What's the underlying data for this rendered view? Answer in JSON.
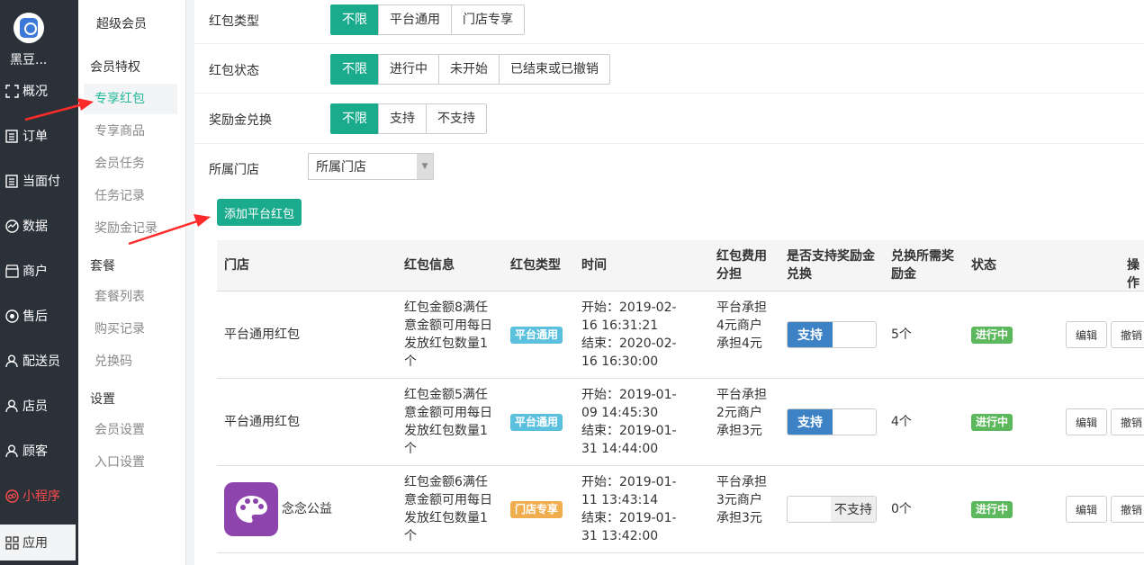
{
  "nav": {
    "brand": "黑豆...",
    "items": [
      {
        "label": "概况",
        "icon": "overview-icon"
      },
      {
        "label": "订单",
        "icon": "order-icon"
      },
      {
        "label": "当面付",
        "icon": "face-pay-icon"
      },
      {
        "label": "数据",
        "icon": "data-icon"
      },
      {
        "label": "商户",
        "icon": "merchant-icon"
      },
      {
        "label": "售后",
        "icon": "after-sale-icon"
      },
      {
        "label": "配送员",
        "icon": "courier-icon"
      },
      {
        "label": "店员",
        "icon": "clerk-icon"
      },
      {
        "label": "顾客",
        "icon": "customer-icon"
      },
      {
        "label": "小程序",
        "icon": "mini-program-icon"
      },
      {
        "label": "应用",
        "icon": "apps-icon"
      }
    ],
    "accent_red": "#ff4a4a"
  },
  "submenu": {
    "title": "超级会员",
    "group1": "会员特权",
    "links1": [
      "专享红包",
      "专享商品",
      "会员任务",
      "任务记录",
      "奖励金记录"
    ],
    "group2": "套餐",
    "links2": [
      "套餐列表",
      "购买记录",
      "兑换码"
    ],
    "group3": "设置",
    "links3": [
      "会员设置",
      "入口设置"
    ]
  },
  "filters": {
    "type": {
      "label": "红包类型",
      "options": [
        "不限",
        "平台通用",
        "门店专享"
      ]
    },
    "status": {
      "label": "红包状态",
      "options": [
        "不限",
        "进行中",
        "未开始",
        "已结束或已撤销"
      ]
    },
    "reward": {
      "label": "奖励金兑换",
      "options": [
        "不限",
        "支持",
        "不支持"
      ]
    },
    "store": {
      "label": "所属门店",
      "value": "所属门店"
    }
  },
  "add_button": "添加平台红包",
  "accent_color": "#1aaa8c",
  "table": {
    "headers": {
      "store": "门店",
      "info": "红包信息",
      "type": "红包类型",
      "time": "时间",
      "cost": "红包费用分担",
      "reward": "是否支持奖励金兑换",
      "needed": "兑换所需奖励金",
      "status": "状态",
      "ops": "操作"
    },
    "rows": [
      {
        "store": "平台通用红包",
        "info": "红包金额8满任意金额可用每日发放红包数量1个",
        "type": "平台通用",
        "start": "开始：2019-02-16 16:31:21",
        "end": "结束：2020-02-16 16:30:00",
        "cost": "平台承担4元商户承担4元",
        "reward": "支持",
        "needed": "5个",
        "status": "进行中",
        "edit": "编辑",
        "revoke": "撤销"
      },
      {
        "store": "平台通用红包",
        "info": "红包金额5满任意金额可用每日发放红包数量1个",
        "type": "平台通用",
        "start": "开始：2019-01-09 14:45:30",
        "end": "结束：2019-01-31 14:44:00",
        "cost": "平台承担2元商户承担3元",
        "reward": "支持",
        "needed": "4个",
        "status": "进行中",
        "edit": "编辑",
        "revoke": "撤销"
      },
      {
        "store": "念念公益",
        "info": "红包金额6满任意金额可用每日发放红包数量1个",
        "type": "门店专享",
        "start": "开始：2019-01-11 13:43:14",
        "end": "结束：2019-01-31 13:42:00",
        "cost": "平台承担3元商户承担3元",
        "reward": "不支持",
        "needed": "0个",
        "status": "进行中",
        "edit": "编辑",
        "revoke": "撤销"
      }
    ]
  }
}
